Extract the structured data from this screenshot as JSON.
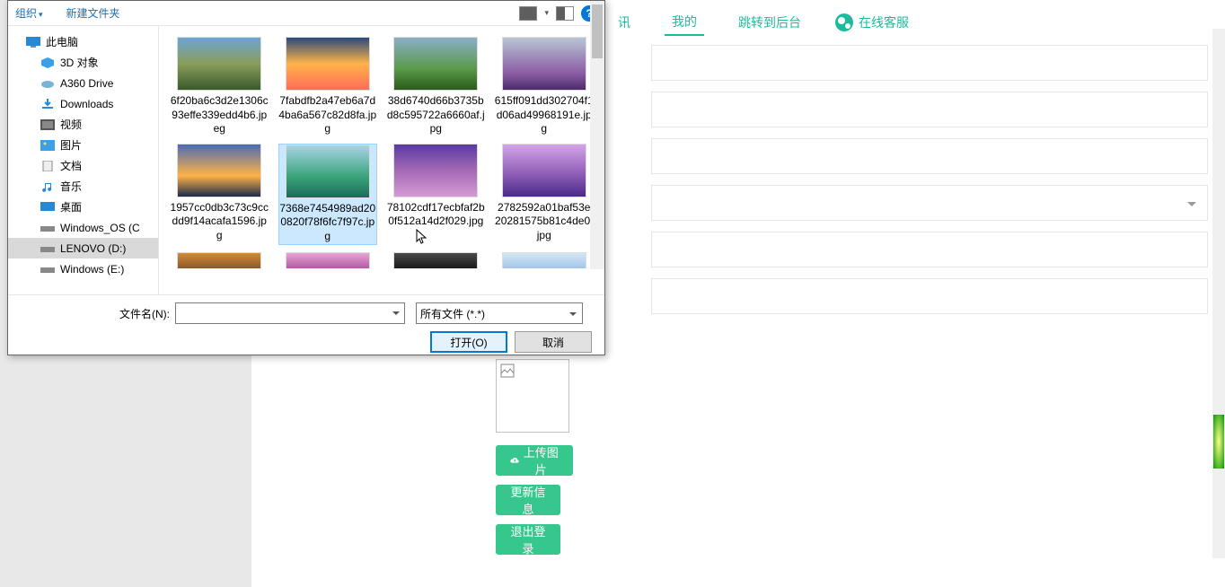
{
  "nav": {
    "tab1": "讯",
    "tab2": "我的",
    "tab3": "跳转到后台",
    "service": "在线客服"
  },
  "buttons": {
    "upload": "上传图片",
    "update": "更新信息",
    "logout": "退出登录"
  },
  "dialog": {
    "toolbar": {
      "organize": "组织",
      "new_folder": "新建文件夹"
    },
    "tree": {
      "this_pc": "此电脑",
      "objects_3d": "3D 对象",
      "a360": "A360 Drive",
      "downloads": "Downloads",
      "videos": "视频",
      "pictures": "图片",
      "documents": "文档",
      "music": "音乐",
      "desktop": "桌面",
      "win_os": "Windows_OS (C",
      "lenovo": "LENOVO (D:)",
      "win_e": "Windows (E:)"
    },
    "files": [
      {
        "name": "6f20ba6c3d2e1306c93effe339edd4b6.jpeg",
        "c": "linear-gradient(180deg,#6ba5d4 0%,#8a9d5a 50%,#3a5a2a 100%)"
      },
      {
        "name": "7fabdfb2a47eb6a7d4ba6a567c82d8fa.jpg",
        "c": "linear-gradient(180deg,#2a4a7a 0%,#ffb347 50%,#ff6b5b 100%)"
      },
      {
        "name": "38d6740d66b3735bd8c595722a6660af.jpg",
        "c": "linear-gradient(180deg,#8aaec7 0%,#5a9a4a 60%,#2a5a1a 100%)"
      },
      {
        "name": "615ff091dd302704f1d06ad49968191e.jpg",
        "c": "linear-gradient(180deg,#b8c5d4 0%,#8a5aa4 70%,#4a2a6a 100%)"
      },
      {
        "name": "1957cc0db3c73c9ccdd9f14acafa1596.jpg",
        "c": "linear-gradient(180deg,#4a6ab4 0%,#ffb347 60%,#1a2a4a 100%)"
      },
      {
        "name": "7368e7454989ad200820f78f6fc7f97c.jpg",
        "c": "linear-gradient(180deg,#a8d4e8 0%,#3aa47a 60%,#1a6a5a 100%)"
      },
      {
        "name": "78102cdf17ecbfaf2b0f512a14d2f029.jpg",
        "c": "linear-gradient(180deg,#5a3aa4 0%,#a46ab4 50%,#d49ad4 100%)"
      },
      {
        "name": "2782592a01baf53e20281575b81c4de0.jpg",
        "c": "linear-gradient(180deg,#d4a4e8 0%,#8a5ab4 60%,#4a2a8a 100%)"
      }
    ],
    "partial_row_colors": [
      "linear-gradient(180deg,#d48a3a,#8a5a2a)",
      "linear-gradient(180deg,#e8a4d4,#b45aa4)",
      "linear-gradient(180deg,#4a4a4a,#1a1a1a)",
      "linear-gradient(180deg,#d4e8f4,#a4c4e8)"
    ],
    "filename_label": "文件名(N):",
    "filename_value": "",
    "filter": "所有文件 (*.*)",
    "open": "打开(O)",
    "cancel": "取消"
  }
}
